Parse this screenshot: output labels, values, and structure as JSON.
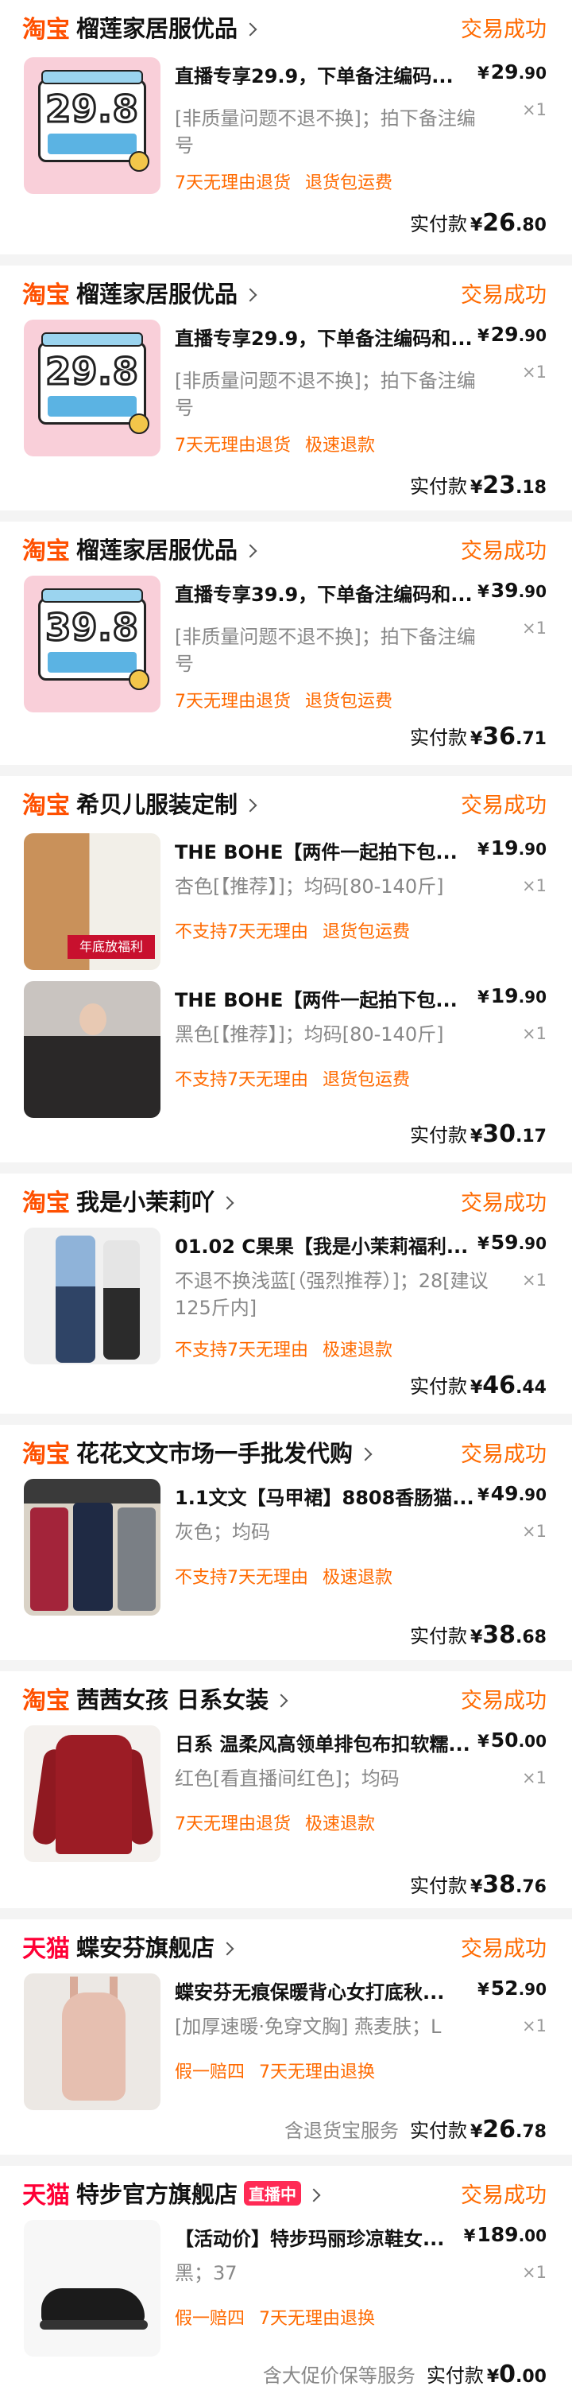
{
  "orders": [
    {
      "platform": "淘宝",
      "platform_type": "taobao",
      "shop": "榴莲家居服优品",
      "status": "交易成功",
      "items": [
        {
          "thumb_text": "29.8",
          "title": "直播专享29.9，下单备注编码...",
          "spec": "[非质量问题不退不换]；拍下备注编号",
          "qty": "×1",
          "price_int": "29",
          "price_dec": ".90",
          "tags": [
            "7天无理由退货",
            "退货包运费"
          ]
        }
      ],
      "paid_label": "实付款",
      "paid_int": "26",
      "paid_dec": ".80"
    },
    {
      "platform": "淘宝",
      "platform_type": "taobao",
      "shop": "榴莲家居服优品",
      "status": "交易成功",
      "items": [
        {
          "thumb_text": "29.8",
          "title": "直播专享29.9，下单备注编码和...",
          "spec": "[非质量问题不退不换]；拍下备注编号",
          "qty": "×1",
          "price_int": "29",
          "price_dec": ".90",
          "tags": [
            "7天无理由退货",
            "极速退款"
          ]
        }
      ],
      "paid_label": "实付款",
      "paid_int": "23",
      "paid_dec": ".18"
    },
    {
      "platform": "淘宝",
      "platform_type": "taobao",
      "shop": "榴莲家居服优品",
      "status": "交易成功",
      "items": [
        {
          "thumb_text": "39.8",
          "title": "直播专享39.9，下单备注编码和...",
          "spec": "[非质量问题不退不换]；拍下备注编号",
          "qty": "×1",
          "price_int": "39",
          "price_dec": ".90",
          "tags": [
            "7天无理由退货",
            "退货包运费"
          ]
        }
      ],
      "paid_label": "实付款",
      "paid_int": "36",
      "paid_dec": ".71"
    },
    {
      "platform": "淘宝",
      "platform_type": "taobao",
      "shop": "希贝儿服装定制",
      "status": "交易成功",
      "items": [
        {
          "thumb_text": "年底放福利",
          "title": "THE BOHE【两件一起拍下包...",
          "spec": "杏色[【推荐】]；均码[80-140斤]",
          "qty": "×1",
          "price_int": "19",
          "price_dec": ".90",
          "tags": [
            "不支持7天无理由",
            "退货包运费"
          ]
        },
        {
          "thumb_text": "",
          "title": "THE BOHE【两件一起拍下包...",
          "spec": "黑色[【推荐】]；均码[80-140斤]",
          "qty": "×1",
          "price_int": "19",
          "price_dec": ".90",
          "tags": [
            "不支持7天无理由",
            "退货包运费"
          ]
        }
      ],
      "paid_label": "实付款",
      "paid_int": "30",
      "paid_dec": ".17"
    },
    {
      "platform": "淘宝",
      "platform_type": "taobao",
      "shop": "我是小茉莉吖",
      "status": "交易成功",
      "items": [
        {
          "thumb_text": "",
          "title": "01.02 C果果【我是小茉莉福利...",
          "spec": "不退不换浅蓝[（强烈推荐）]；28[建议125斤内]",
          "qty": "×1",
          "price_int": "59",
          "price_dec": ".90",
          "tags": [
            "不支持7天无理由",
            "极速退款"
          ]
        }
      ],
      "paid_label": "实付款",
      "paid_int": "46",
      "paid_dec": ".44"
    },
    {
      "platform": "淘宝",
      "platform_type": "taobao",
      "shop": "花花文文市场一手批发代购",
      "status": "交易成功",
      "items": [
        {
          "thumb_text": "",
          "title": "1.1文文【马甲裙】8808香肠猫...",
          "spec": "灰色；均码",
          "qty": "×1",
          "price_int": "49",
          "price_dec": ".90",
          "tags": [
            "不支持7天无理由",
            "极速退款"
          ]
        }
      ],
      "paid_label": "实付款",
      "paid_int": "38",
      "paid_dec": ".68"
    },
    {
      "platform": "淘宝",
      "platform_type": "taobao",
      "shop": "茜茜女孩 日系女装",
      "status": "交易成功",
      "items": [
        {
          "thumb_text": "",
          "title": "日系 温柔风高领单排包布扣软糯...",
          "spec": "红色[看直播间红色]；均码",
          "qty": "×1",
          "price_int": "50",
          "price_dec": ".00",
          "tags": [
            "7天无理由退货",
            "极速退款"
          ]
        }
      ],
      "paid_label": "实付款",
      "paid_int": "38",
      "paid_dec": ".76"
    },
    {
      "platform": "天猫",
      "platform_type": "tmall",
      "shop": "蝶安芬旗舰店",
      "status": "交易成功",
      "items": [
        {
          "thumb_text": "",
          "title": "蝶安芬无痕保暖背心女打底秋...",
          "spec": "[加厚速暖·免穿文胸] 燕麦肤；L",
          "qty": "×1",
          "price_int": "52",
          "price_dec": ".90",
          "tags": [
            "假一赔四",
            "7天无理由退换"
          ]
        }
      ],
      "paid_extra": "含退货宝服务",
      "paid_label": "实付款",
      "paid_int": "26",
      "paid_dec": ".78"
    },
    {
      "platform": "天猫",
      "platform_type": "tmall",
      "shop": "特步官方旗舰店",
      "live_badge": "直播中",
      "status": "交易成功",
      "items": [
        {
          "thumb_text": "",
          "title": "【活动价】特步玛丽珍凉鞋女...",
          "spec": "黑；37",
          "qty": "×1",
          "price_int": "189",
          "price_dec": ".00",
          "tags": [
            "假一赔四",
            "7天无理由退换"
          ]
        }
      ],
      "paid_extra": "含大促价保等服务",
      "paid_label": "实付款",
      "paid_int": "0",
      "paid_dec": ".00"
    }
  ],
  "currency_symbol": "¥"
}
